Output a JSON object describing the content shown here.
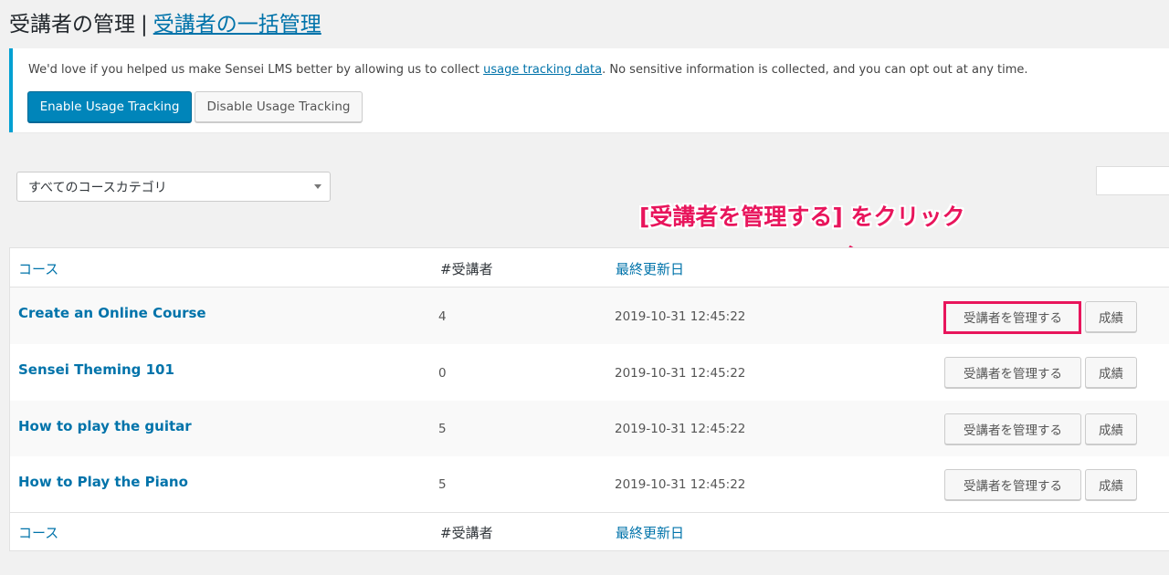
{
  "header": {
    "title": "受講者の管理",
    "separator": "|",
    "bulk_link": "受講者の一括管理"
  },
  "notice": {
    "text_before": "We'd love if you helped us make Sensei LMS better by allowing us to collect ",
    "link": "usage tracking data",
    "text_after": ". No sensitive information is collected, and you can opt out at any time.",
    "enable_label": "Enable Usage Tracking",
    "disable_label": "Disable Usage Tracking"
  },
  "filter": {
    "category_selected": "すべてのコースカテゴリ"
  },
  "table": {
    "columns": [
      "コース",
      "#受講者",
      "最終更新日"
    ],
    "rows": [
      {
        "course": "Create an Online Course",
        "learners": "4",
        "updated": "2019-10-31 12:45:22"
      },
      {
        "course": "Sensei Theming 101",
        "learners": "0",
        "updated": "2019-10-31 12:45:22"
      },
      {
        "course": "How to play the guitar",
        "learners": "5",
        "updated": "2019-10-31 12:45:22"
      },
      {
        "course": "How to Play the Piano",
        "learners": "5",
        "updated": "2019-10-31 12:45:22"
      }
    ],
    "manage_label": "受講者を管理する",
    "grade_label": "成績"
  },
  "annotation": {
    "text": "[受講者を管理する] をクリック",
    "color": "#e8155c"
  }
}
